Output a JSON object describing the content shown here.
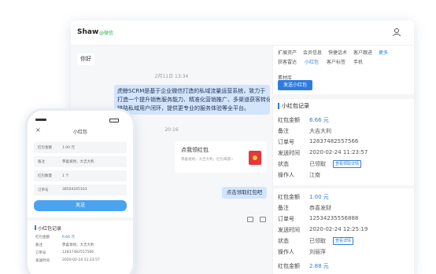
{
  "desktop": {
    "header": {
      "name": "Shaw",
      "status": "@微信"
    },
    "chat": {
      "greeting": "你好",
      "timestamp_1": "2月11日 13:34",
      "message_lines": [
        "虎鲸SCRM是基于企业微信打造的私域流量运营系统，致力于",
        "打造一个提升销售服务能力、精准化营销推广、多渠道获客转化全",
        "链路私域用户闭环，提供更专业的服务体验等全平台。"
      ],
      "timestamp_2": "20:16",
      "red_card": {
        "title": "点我领红包",
        "desc": "恭喜发财，大吉大利，红包来袭~"
      },
      "reply": "点击领取红包吧"
    },
    "sidebar": {
      "tabs_row1": [
        "扩展资产",
        "会员信息",
        "快捷话术",
        "客户跟进",
        "更多"
      ],
      "tabs_row2": [
        "获客雷达",
        "小红包",
        "客户标签",
        "手机"
      ],
      "tabs_row3": [
        "素材库"
      ],
      "send_button": "发送小红包",
      "section_title": "小红包记录",
      "records": [
        {
          "rows": [
            {
              "label": "红包金额",
              "value": "6.66 元"
            },
            {
              "label": "备注",
              "value": "大吉大利"
            },
            {
              "label": "订单号",
              "value": "12837482557566"
            },
            {
              "label": "发送时间",
              "value": "2020-02-24 11:23:57"
            },
            {
              "label": "状态",
              "value": "已领取",
              "tag": "查看领取详情"
            },
            {
              "label": "操作人",
              "value": "江南"
            }
          ]
        },
        {
          "rows": [
            {
              "label": "红包金额",
              "value": "1.00 元"
            },
            {
              "label": "备注",
              "value": "恭喜发财"
            },
            {
              "label": "订单号",
              "value": "12534235556888"
            },
            {
              "label": "发送时间",
              "value": "2020-02-24 12:25:19"
            },
            {
              "label": "状态",
              "value": "已领取",
              "tag": "查看详情"
            },
            {
              "label": "操作人",
              "value": "刘丽萍"
            }
          ]
        },
        {
          "rows": [
            {
              "label": "红包金额",
              "value": "2.88 元"
            }
          ]
        }
      ]
    }
  },
  "phone": {
    "title": "小红包",
    "form": [
      {
        "label": "红包金额",
        "value": "1.00 元"
      },
      {
        "label": "备注",
        "value": "恭喜发财，大吉大利"
      },
      {
        "label": "红包数量",
        "value": "1 个"
      },
      {
        "label": "订单号",
        "value": "38504245103"
      }
    ],
    "send_button": "发送",
    "section_title": "小红包记录",
    "records": [
      {
        "label": "红包金额",
        "value": "6.66 元"
      },
      {
        "label": "备注",
        "value": "恭喜发财，大吉大利"
      },
      {
        "label": "订单号",
        "value": "12837482557566"
      },
      {
        "label": "发送时间",
        "value": "2020-02-24 11:23:57"
      }
    ]
  }
}
